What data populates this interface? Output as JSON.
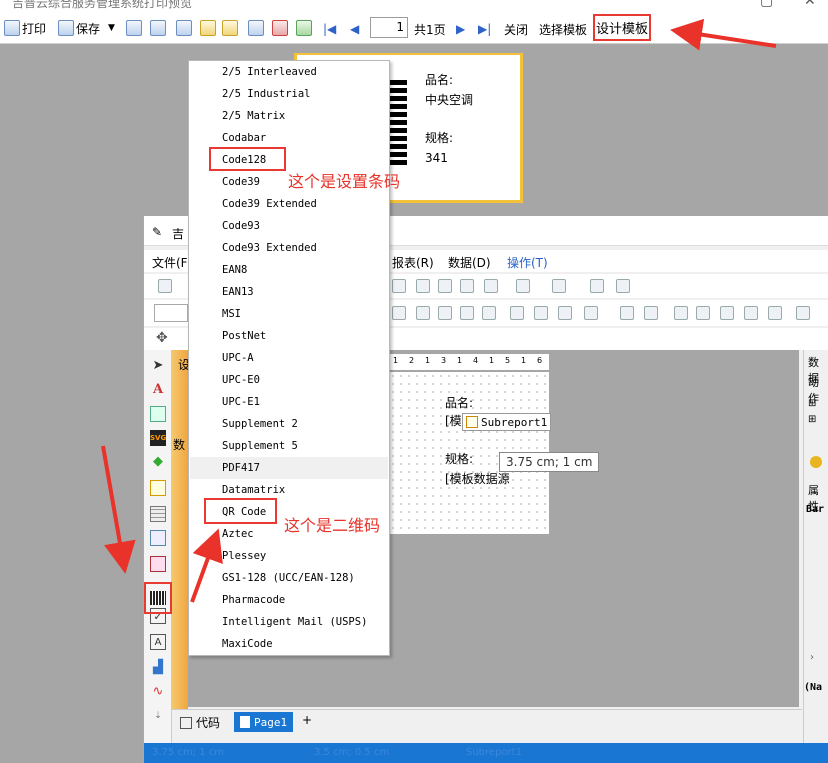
{
  "viewer": {
    "title": "吉普云综合服务管理系统打印预览",
    "toolbar": {
      "print_label": "打印",
      "save_label": "保存",
      "page_value": "1",
      "total_pages": "共1页",
      "close_label": "关闭",
      "select_template_label": "选择模板",
      "design_template_label": "设计模板"
    }
  },
  "preview": {
    "name_label": "品名:",
    "name_value": "中央空调",
    "spec_label": "规格:",
    "spec_value": "341"
  },
  "designer": {
    "title": "吉",
    "menu": [
      {
        "label": "文件(F"
      },
      {
        "label": "报表(R)"
      },
      {
        "label": "数据(D)"
      },
      {
        "label": "操作(T)"
      }
    ],
    "side_tab": "设",
    "design_band": "数",
    "ruler_ticks": [
      "1",
      "2",
      "1",
      "3",
      "1",
      "4",
      "1",
      "5",
      "1",
      "6"
    ],
    "canvas": {
      "name_label": "品名:",
      "field1": "[模",
      "spec_label": "规格:",
      "field2": "[模板数据源",
      "subreport": "Subreport1",
      "size_tooltip": "3.75 cm; 1 cm"
    },
    "right_panel": {
      "data_header": "数据",
      "action_header": "动作",
      "props_header": "属性",
      "bar_label": "Bar",
      "na_label": "(Na"
    },
    "bottom_tabs": {
      "code_label": "代码",
      "page_label": "Page1",
      "add_label": "+"
    },
    "status": {
      "left": "3.75 cm; 1 cm",
      "mid": "3.5 cm; 0.5 cm",
      "right": "Subreport1"
    }
  },
  "barcode_menu": {
    "items": [
      "2/5 Interleaved",
      "2/5 Industrial",
      "2/5 Matrix",
      "Codabar",
      "Code128",
      "Code39",
      "Code39 Extended",
      "Code93",
      "Code93 Extended",
      "EAN8",
      "EAN13",
      "MSI",
      "PostNet",
      "UPC-A",
      "UPC-E0",
      "UPC-E1",
      "Supplement 2",
      "Supplement 5",
      "PDF417",
      "Datamatrix",
      "QR Code",
      "Aztec",
      "Plessey",
      "GS1-128 (UCC/EAN-128)",
      "Pharmacode",
      "Intelligent Mail (USPS)",
      "MaxiCode"
    ],
    "highlighted": "PDF417"
  },
  "annotations": {
    "barcode_note": "这个是设置条码",
    "qrcode_note": "这个是二维码",
    "color": "#e8322a"
  }
}
